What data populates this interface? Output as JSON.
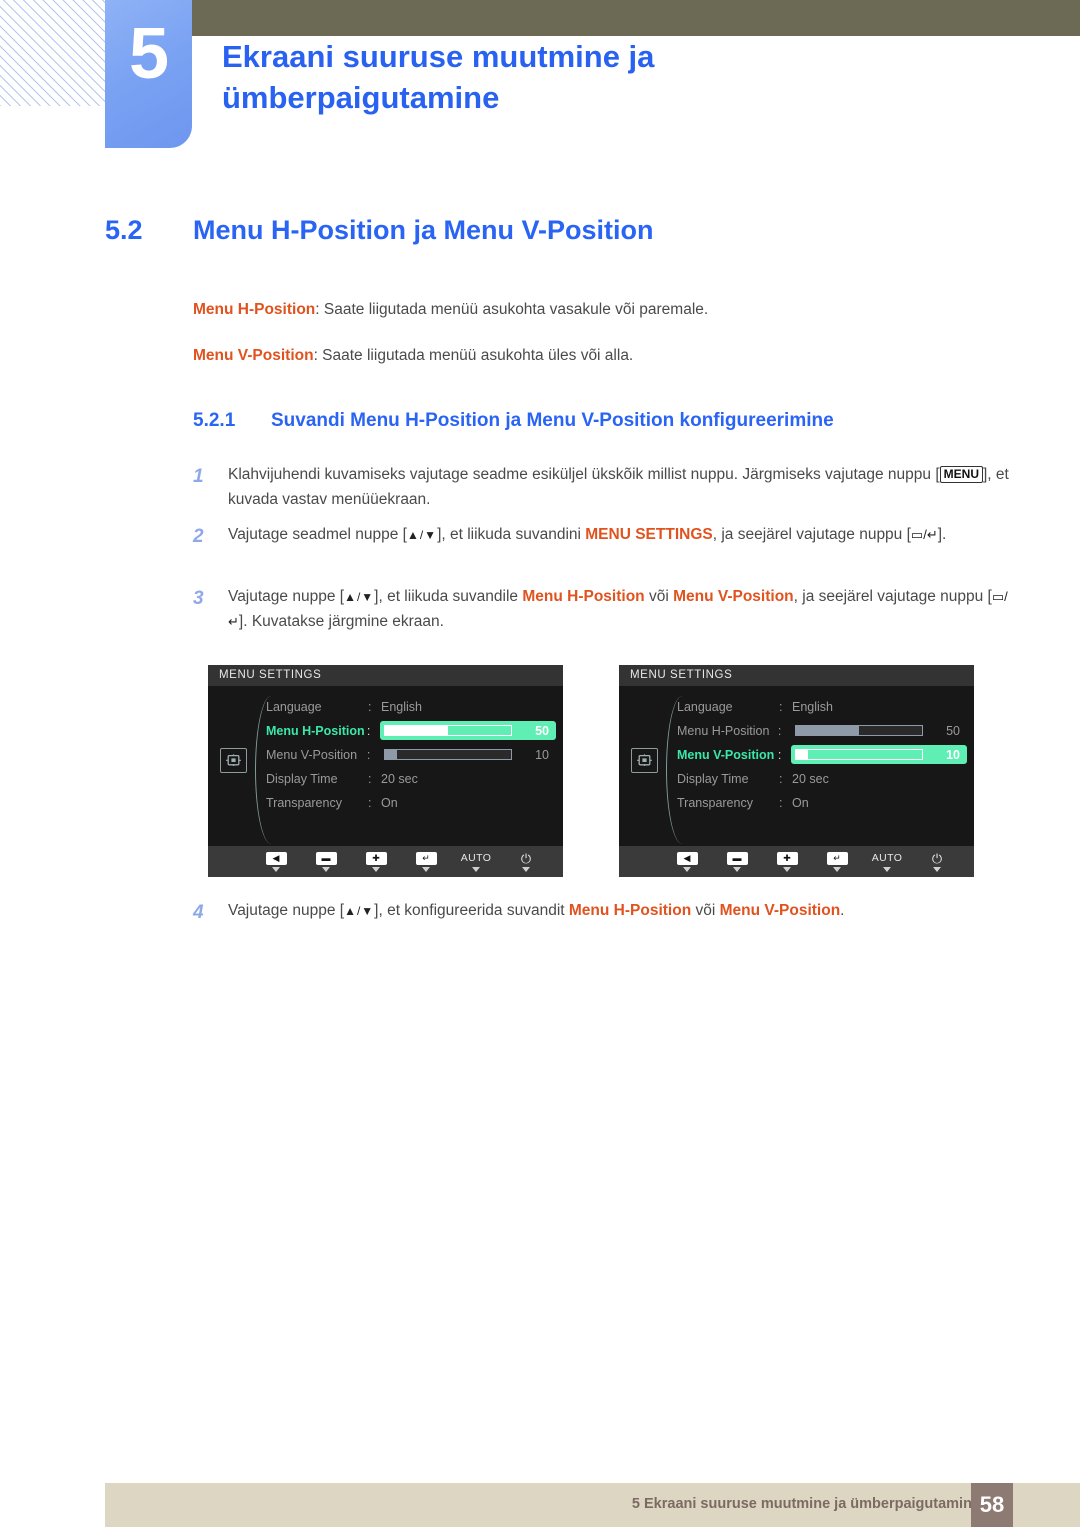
{
  "header": {
    "chapter_number": "5",
    "chapter_title_line1": "Ekraani suuruse muutmine ja",
    "chapter_title_line2": "ümberpaigutamine",
    "accent_blue": "#2962f0",
    "badge_blue": "#7ba3f3",
    "olive": "#6c6a55"
  },
  "section": {
    "number": "5.2",
    "title": "Menu H-Position ja Menu V-Position"
  },
  "intro": {
    "line1_term": "Menu H-Position",
    "line1_rest": ": Saate liigutada menüü asukohta vasakule või paremale.",
    "line2_term": "Menu V-Position",
    "line2_rest": ": Saate liigutada menüü asukohta üles või alla."
  },
  "subsection": {
    "number": "5.2.1",
    "title": "Suvandi Menu H-Position ja Menu V-Position konfigureerimine"
  },
  "steps": {
    "s1_num": "1",
    "s1_a": "Klahvijuhendi kuvamiseks vajutage seadme esiküljel ükskõik millist nuppu. Järgmiseks vajutage nuppu [",
    "s1_key": "MENU",
    "s1_b": "], et kuvada vastav menüüekraan.",
    "s2_num": "2",
    "s2_a": "Vajutage seadmel nuppe [",
    "s2_keys": "▲/▼",
    "s2_b": "], et liikuda suvandini ",
    "s2_term": "MENU SETTINGS",
    "s2_c": ", ja seejärel vajutage nuppu [",
    "s2_key2": "▭/↵",
    "s2_d": "].",
    "s3_num": "3",
    "s3_a": "Vajutage nuppe [",
    "s3_keys": "▲/▼",
    "s3_b": "], et liikuda suvandile ",
    "s3_term1": "Menu H-Position",
    "s3_c": " või ",
    "s3_term2": "Menu V-Position",
    "s3_d": ", ja seejärel vajutage nuppu [",
    "s3_key2": "▭/↵",
    "s3_e": "]. Kuvatakse järgmine ekraan.",
    "s4_num": "4",
    "s4_a": "Vajutage nuppe [",
    "s4_keys": "▲/▼",
    "s4_b": "], et konfigureerida suvandit ",
    "s4_term1": "Menu H-Position",
    "s4_c": " või ",
    "s4_term2": "Menu V-Position",
    "s4_d": "."
  },
  "osd": {
    "highlight_green": "#5fefb4",
    "label_green": "#3ae8a8",
    "inactive_bar": "#8f9aa8",
    "left": {
      "title": "MENU SETTINGS",
      "rows": [
        {
          "label": "Language",
          "colon": ":",
          "value": "English",
          "type": "text",
          "active": false
        },
        {
          "label": "Menu H-Position",
          "colon": ":",
          "value": "50",
          "type": "bar",
          "percent": 50,
          "active": true
        },
        {
          "label": "Menu V-Position",
          "colon": ":",
          "value": "10",
          "type": "bar",
          "percent": 10,
          "active": false
        },
        {
          "label": "Display Time",
          "colon": ":",
          "value": "20 sec",
          "type": "text",
          "active": false
        },
        {
          "label": "Transparency",
          "colon": ":",
          "value": "On",
          "type": "text",
          "active": false
        }
      ]
    },
    "right": {
      "title": "MENU SETTINGS",
      "rows": [
        {
          "label": "Language",
          "colon": ":",
          "value": "English",
          "type": "text",
          "active": false
        },
        {
          "label": "Menu H-Position",
          "colon": ":",
          "value": "50",
          "type": "bar",
          "percent": 50,
          "active": false
        },
        {
          "label": "Menu V-Position",
          "colon": ":",
          "value": "10",
          "type": "bar",
          "percent": 10,
          "active": true
        },
        {
          "label": "Display Time",
          "colon": ":",
          "value": "20 sec",
          "type": "text",
          "active": false
        },
        {
          "label": "Transparency",
          "colon": ":",
          "value": "On",
          "type": "text",
          "active": false
        }
      ]
    },
    "footer_buttons": [
      {
        "icon": "left-arrow-icon",
        "glyph": "◀"
      },
      {
        "icon": "minus-icon",
        "glyph": "▬"
      },
      {
        "icon": "plus-icon",
        "glyph": "✚"
      },
      {
        "icon": "enter-icon",
        "glyph": "↵"
      },
      {
        "icon": "auto-label",
        "glyph": "AUTO"
      },
      {
        "icon": "power-icon",
        "glyph": "⏻"
      }
    ]
  },
  "footer": {
    "text": "5 Ekraani suuruse muutmine ja ümberpaigutamine",
    "page": "58",
    "bar_color": "#ddd6c3",
    "page_box_color": "#8d7b73"
  }
}
